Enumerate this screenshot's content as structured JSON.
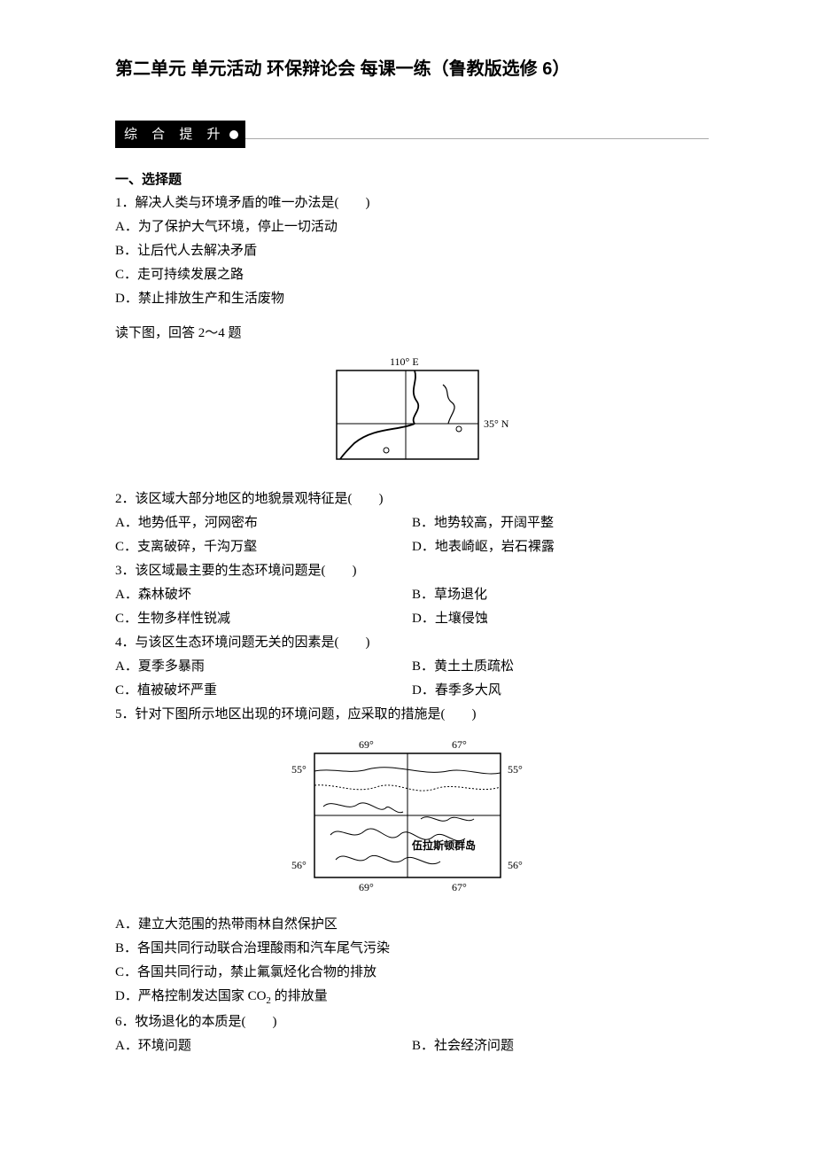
{
  "title": "第二单元 单元活动 环保辩论会 每课一练（鲁教版选修 6）",
  "sectionBanner": "综 合 提 升",
  "sec1": "一、选择题",
  "q1": {
    "stem": "1．解决人类与环境矛盾的唯一办法是(　　)",
    "a": "A．为了保护大气环境，停止一切活动",
    "b": "B．让后代人去解决矛盾",
    "c": "C．走可持续发展之路",
    "d": "D．禁止排放生产和生活废物"
  },
  "passage1": "读下图，回答 2～4 题",
  "fig1": {
    "lon": "110° E",
    "lat": "35° N"
  },
  "q2": {
    "stem": "2．该区域大部分地区的地貌景观特征是(　　)",
    "a": "A．地势低平，河网密布",
    "b": "B．地势较高，开阔平整",
    "c": "C．支离破碎，千沟万壑",
    "d": "D．地表崎岖，岩石裸露"
  },
  "q3": {
    "stem": "3．该区域最主要的生态环境问题是(　　)",
    "a": "A．森林破坏",
    "b": "B．草场退化",
    "c": "C．生物多样性锐减",
    "d": "D．土壤侵蚀"
  },
  "q4": {
    "stem": "4．与该区生态环境问题无关的因素是(　　)",
    "a": "A．夏季多暴雨",
    "b": "B．黄土土质疏松",
    "c": "C．植被破坏严重",
    "d": "D．春季多大风"
  },
  "q5": {
    "stem": "5．针对下图所示地区出现的环境问题，应采取的措施是(　　)",
    "a": "A．建立大范围的热带雨林自然保护区",
    "b": "B．各国共同行动联合治理酸雨和汽车尾气污染",
    "c": "C．各国共同行动，禁止氟氯烃化合物的排放",
    "d_pre": "D．严格控制发达国家 CO",
    "d_sub": "2",
    "d_post": " 的排放量"
  },
  "fig2": {
    "lon1": "69°",
    "lon2": "67°",
    "lat1": "55°",
    "lat2": "56°",
    "island": "伍拉斯顿群岛"
  },
  "q6": {
    "stem": "6．牧场退化的本质是(　　)",
    "a": "A．环境问题",
    "b": "B．社会经济问题"
  }
}
